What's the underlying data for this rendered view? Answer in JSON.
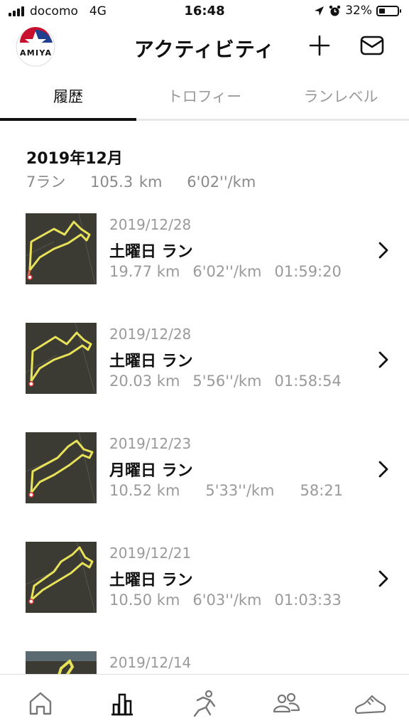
{
  "status_bar": {
    "carrier": "docomo",
    "network": "4G",
    "time": "16:48",
    "battery": "32%"
  },
  "header": {
    "title": "アクティビティ",
    "logo_text": "AMIYA"
  },
  "tabs": [
    {
      "label": "履歴",
      "active": true
    },
    {
      "label": "トロフィー",
      "active": false
    },
    {
      "label": "ランレベル",
      "active": false
    }
  ],
  "month": {
    "title": "2019年12月",
    "runs": "7ラン",
    "distance": "105.3 km",
    "pace": "6'02''/km"
  },
  "activities": [
    {
      "date": "2019/12/28",
      "title": "土曜日 ラン",
      "distance": "19.77 km",
      "pace": "6'02''/km",
      "duration": "01:59:20"
    },
    {
      "date": "2019/12/28",
      "title": "土曜日 ラン",
      "distance": "20.03 km",
      "pace": "5'56''/km",
      "duration": "01:58:54"
    },
    {
      "date": "2019/12/23",
      "title": "月曜日 ラン",
      "distance": "10.52 km",
      "pace": "5'33''/km",
      "duration": "58:21"
    },
    {
      "date": "2019/12/21",
      "title": "土曜日 ラン",
      "distance": "10.50 km",
      "pace": "6'03''/km",
      "duration": "01:03:33"
    },
    {
      "date": "2019/12/14",
      "title": "",
      "distance": "",
      "pace": "",
      "duration": ""
    }
  ],
  "colors": {
    "accent": "#111111",
    "muted": "#9a9a9a",
    "route": "#e8e25a"
  },
  "icons": [
    "home-icon",
    "activity-chart-icon",
    "run-icon",
    "club-icon",
    "shoe-icon"
  ]
}
